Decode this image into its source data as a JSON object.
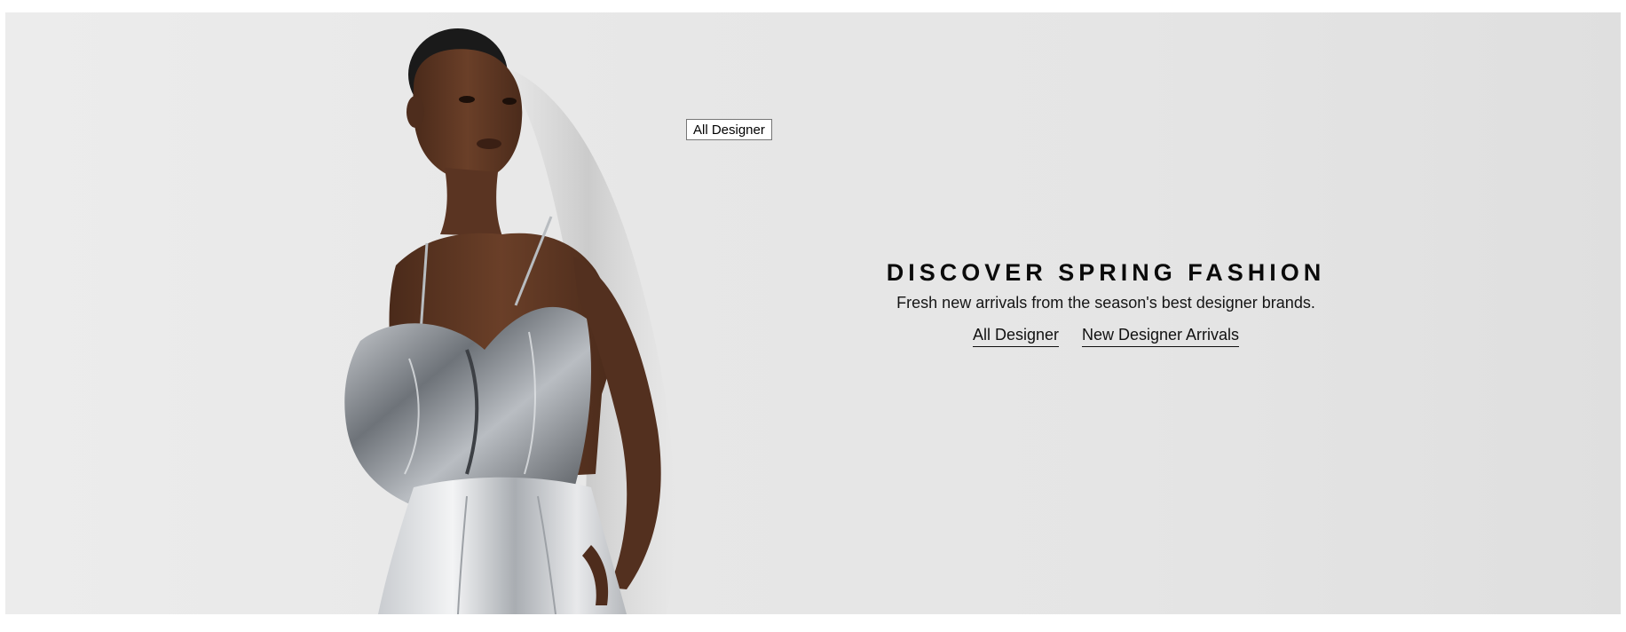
{
  "hero": {
    "image_alt": "Model wearing a metallic silver bow top and silver pleated skirt",
    "tooltip": "All Designer",
    "title": "DISCOVER SPRING FASHION",
    "subtitle": "Fresh new arrivals from the season's best designer brands.",
    "links": [
      {
        "label": "All Designer"
      },
      {
        "label": "New Designer Arrivals"
      }
    ]
  },
  "colors": {
    "background": "#e7e7e7",
    "text": "#111111",
    "skin": "#5a3522",
    "metallic": "#9a9ea4"
  }
}
